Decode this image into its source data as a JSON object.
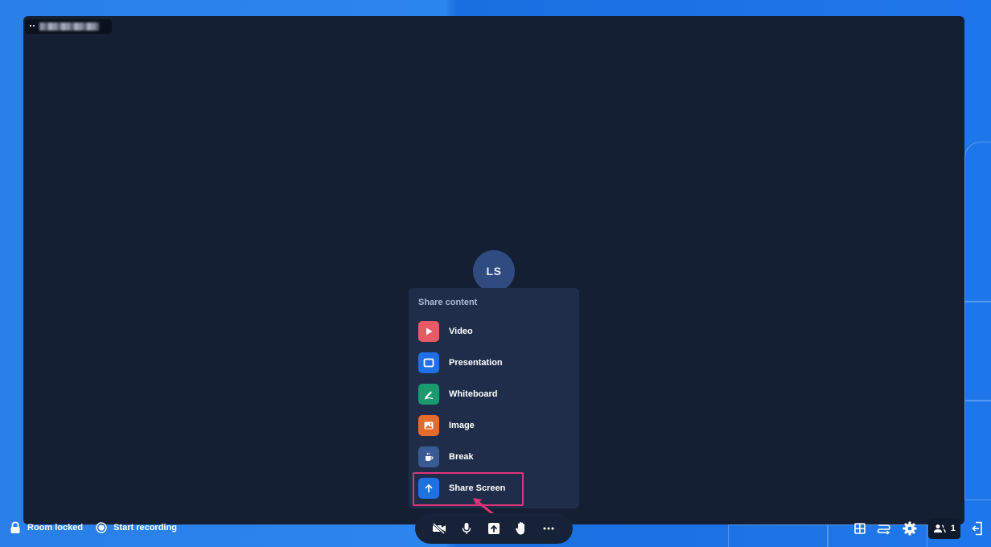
{
  "stage": {
    "name_tag_blurred": "••••••••"
  },
  "participant": {
    "initials": "LS"
  },
  "share_menu": {
    "heading": "Share content",
    "items": [
      {
        "label": "Video",
        "icon": "play-icon",
        "color": "#e85a65"
      },
      {
        "label": "Presentation",
        "icon": "presentation-icon",
        "color": "#1f6fe5"
      },
      {
        "label": "Whiteboard",
        "icon": "whiteboard-pen-icon",
        "color": "#1a9a6e"
      },
      {
        "label": "Image",
        "icon": "image-icon",
        "color": "#e66a2c"
      },
      {
        "label": "Break",
        "icon": "coffee-cup-icon",
        "color": "#3a5a94"
      },
      {
        "label": "Share Screen",
        "icon": "arrow-up-icon",
        "color": "#1f6fe5"
      }
    ]
  },
  "footer_left": {
    "room_locked": "Room locked",
    "start_recording": "Start recording"
  },
  "toolbar": {
    "buttons": [
      "camera-off-icon",
      "microphone-icon",
      "share-icon",
      "raise-hand-icon",
      "more-icon"
    ]
  },
  "footer_right": {
    "participant_count": "1"
  },
  "colors": {
    "stage_bg": "#141f33",
    "menu_bg": "#1f2d4a",
    "highlight": "#e0337a",
    "accent_blue": "#2a7fe8"
  }
}
